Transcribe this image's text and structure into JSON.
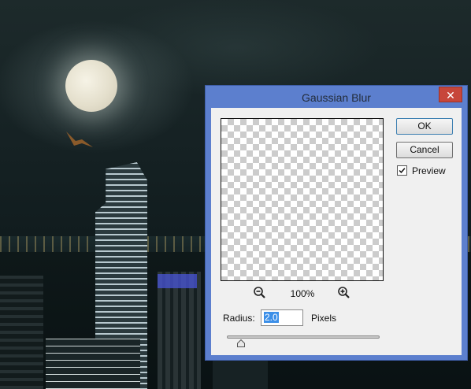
{
  "dialog": {
    "title": "Gaussian Blur",
    "close_symbol": "✕",
    "zoom_level": "100%",
    "ok_label": "OK",
    "cancel_label": "Cancel",
    "preview_label": "Preview",
    "preview_checked": true,
    "radius_label": "Radius:",
    "radius_value": "2.0",
    "units_label": "Pixels",
    "icons": {
      "zoom_out": "zoom-out-icon",
      "zoom_in": "zoom-in-icon",
      "checkmark": "checkmark-icon",
      "slider_thumb": "slider-thumb-icon"
    }
  },
  "colors": {
    "dialog_frame": "#5c7fce",
    "close_button": "#c7463a",
    "selection": "#3c8fe8"
  }
}
